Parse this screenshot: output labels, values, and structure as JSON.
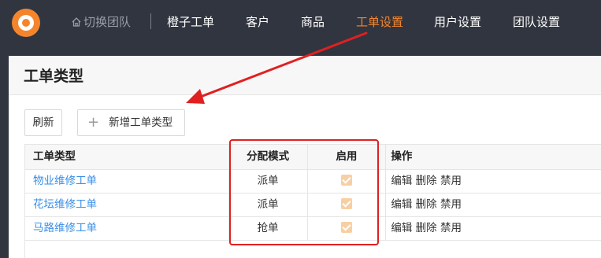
{
  "header": {
    "switch_team": "切换团队",
    "nav": [
      "橙子工单",
      "客户",
      "商品",
      "工单设置",
      "用户设置",
      "团队设置"
    ],
    "active_nav": "工单设置",
    "accent_color": "#f5852c"
  },
  "page": {
    "title": "工单类型",
    "refresh_label": "刷新",
    "add_label": "新增工单类型"
  },
  "table": {
    "columns": [
      "工单类型",
      "分配模式",
      "启用",
      "操作"
    ],
    "rows": [
      {
        "name": "物业维修工单",
        "mode": "派单",
        "enabled": true
      },
      {
        "name": "花坛维修工单",
        "mode": "派单",
        "enabled": true
      },
      {
        "name": "马路维修工单",
        "mode": "抢单",
        "enabled": true
      }
    ],
    "actions": [
      "编辑",
      "删除",
      "禁用"
    ]
  },
  "annotation": {
    "highlight_color": "#e02020"
  }
}
